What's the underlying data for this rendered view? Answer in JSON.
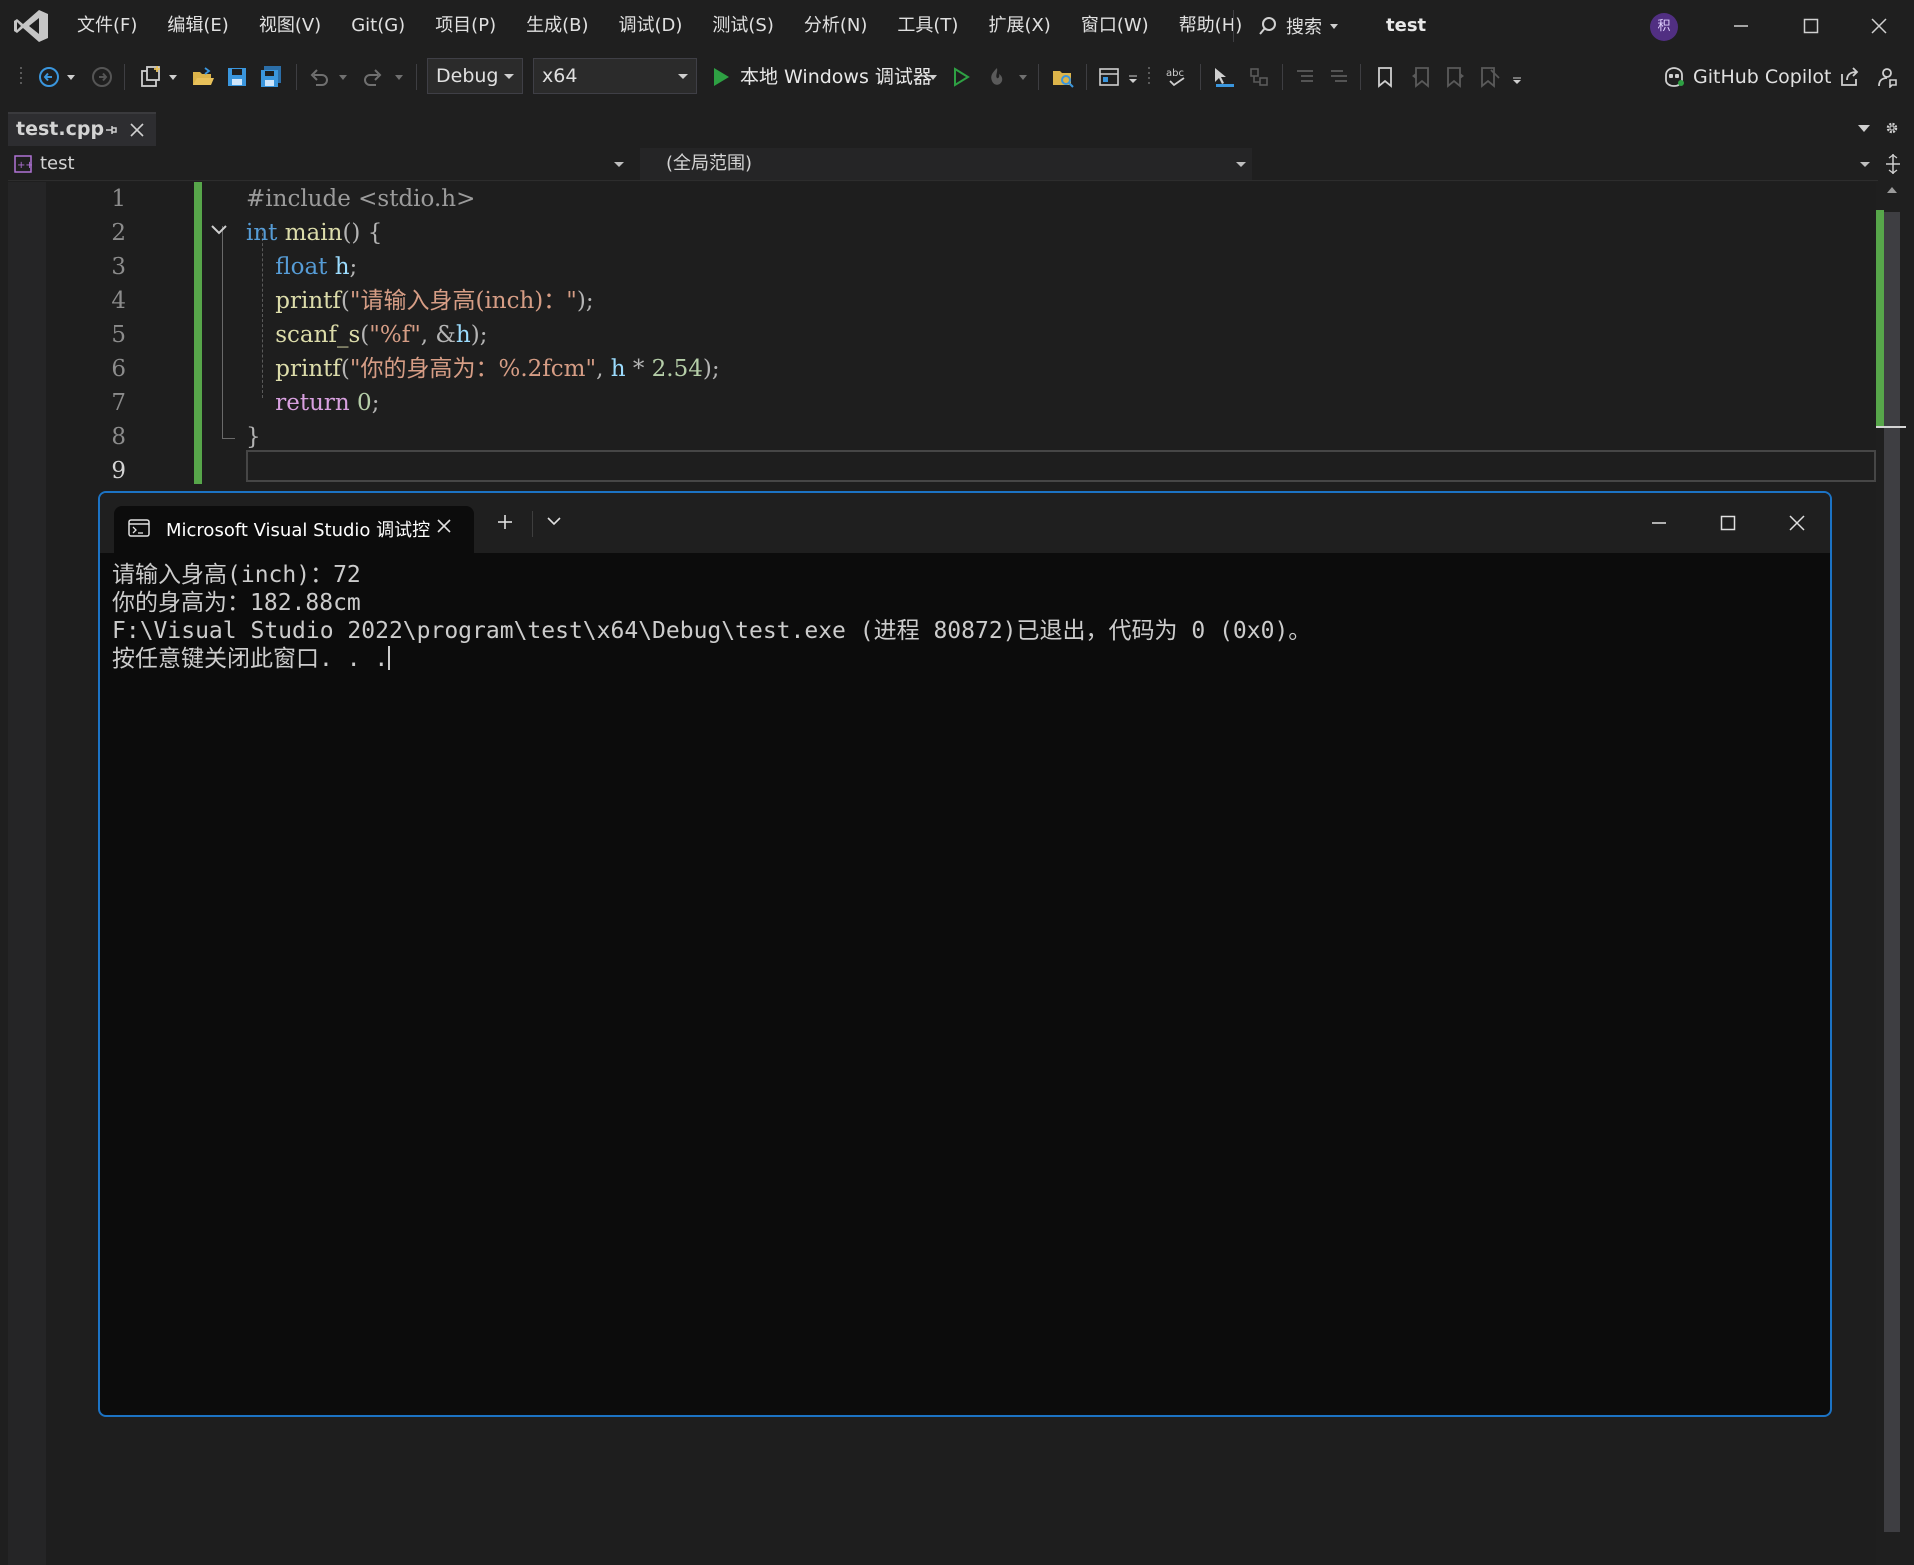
{
  "menubar": {
    "items": [
      "文件(F)",
      "编辑(E)",
      "视图(V)",
      "Git(G)",
      "项目(P)",
      "生成(B)",
      "调试(D)",
      "测试(S)",
      "分析(N)",
      "工具(T)",
      "扩展(X)",
      "窗口(W)",
      "帮助(H)"
    ],
    "search_label": "搜索",
    "solution_name": "test",
    "user_initial": "积"
  },
  "toolbar": {
    "configuration": "Debug",
    "platform": "x64",
    "run_label": "本地 Windows 调试器",
    "copilot_label": "GitHub Copilot"
  },
  "document_tab": {
    "filename": "test.cpp"
  },
  "navbar": {
    "project": "test",
    "scope": "(全局范围)"
  },
  "editor": {
    "line_numbers": [
      "1",
      "2",
      "3",
      "4",
      "5",
      "6",
      "7",
      "8",
      "9"
    ],
    "current_line": 9,
    "code_lines": [
      [
        [
          "pre",
          "#include <stdio.h>"
        ]
      ],
      [
        [
          "kw",
          "int"
        ],
        [
          "plain",
          " "
        ],
        [
          "fn",
          "main"
        ],
        [
          "punc",
          "() {"
        ]
      ],
      [
        [
          "plain",
          "    "
        ],
        [
          "kw",
          "float"
        ],
        [
          "plain",
          " "
        ],
        [
          "id",
          "h"
        ],
        [
          "punc",
          ";"
        ]
      ],
      [
        [
          "plain",
          "    "
        ],
        [
          "fn",
          "printf"
        ],
        [
          "punc",
          "("
        ],
        [
          "str",
          "\"请输入身高(inch)：\""
        ],
        [
          "punc",
          ");"
        ]
      ],
      [
        [
          "plain",
          "    "
        ],
        [
          "fn",
          "scanf_s"
        ],
        [
          "punc",
          "("
        ],
        [
          "str",
          "\"%f\""
        ],
        [
          "punc",
          ", &"
        ],
        [
          "id",
          "h"
        ],
        [
          "punc",
          ");"
        ]
      ],
      [
        [
          "plain",
          "    "
        ],
        [
          "fn",
          "printf"
        ],
        [
          "punc",
          "("
        ],
        [
          "str",
          "\"你的身高为：%.2fcm\""
        ],
        [
          "punc",
          ", "
        ],
        [
          "id",
          "h"
        ],
        [
          "punc",
          " * "
        ],
        [
          "num",
          "2.54"
        ],
        [
          "punc",
          ");"
        ]
      ],
      [
        [
          "plain",
          "    "
        ],
        [
          "ret",
          "return"
        ],
        [
          "plain",
          " "
        ],
        [
          "num",
          "0"
        ],
        [
          "punc",
          ";"
        ]
      ],
      [
        [
          "punc",
          "}"
        ]
      ],
      []
    ]
  },
  "console": {
    "tab_title": "Microsoft Visual Studio 调试控制台",
    "lines": [
      "请输入身高(inch)：72",
      "你的身高为：182.88cm",
      "F:\\Visual Studio 2022\\program\\test\\x64\\Debug\\test.exe (进程 80872)已退出，代码为 0 (0x0)。",
      "按任意键关闭此窗口. . ."
    ]
  },
  "colors": {
    "accent_border": "#1c73c4",
    "change_indicator": "#57a64a",
    "run_green": "#2ea043"
  }
}
